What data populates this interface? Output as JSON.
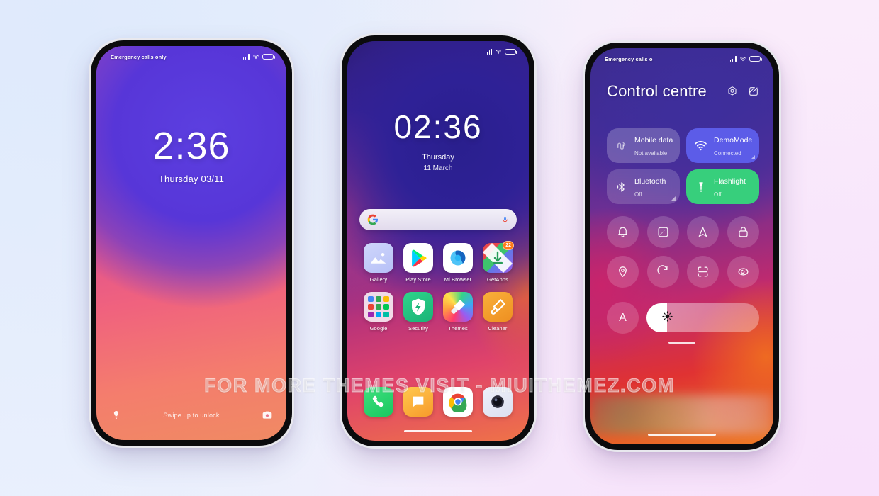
{
  "background": {
    "top_left": "#e3edfc",
    "bottom_right": "#f7e4fb"
  },
  "watermark": {
    "text": "FOR MORE THEMES VISIT - MIUITHEMEZ.COM"
  },
  "phone_lock": {
    "status_bar": {
      "carrier": "Emergency calls only",
      "signal_icon": "signal-bars-icon",
      "wifi_icon": "wifi-icon",
      "battery_icon": "battery-icon"
    },
    "clock": {
      "time": "2:36",
      "date": "Thursday 03/11"
    },
    "footer": {
      "hint": "Swipe up to unlock",
      "left_icon": "flashlight-icon",
      "right_icon": "camera-icon"
    }
  },
  "phone_home": {
    "status_bar": {
      "carrier": "",
      "signal_icon": "signal-bars-icon",
      "wifi_icon": "wifi-icon",
      "battery_icon": "battery-icon"
    },
    "clock": {
      "time": "02:36",
      "day": "Thursday",
      "date": "11 March"
    },
    "search": {
      "placeholder": "",
      "value": "",
      "left_icon": "google-g-icon",
      "right_icon": "microphone-icon"
    },
    "app_rows": [
      [
        {
          "label": "Gallery",
          "icon": "gallery-icon",
          "badge": ""
        },
        {
          "label": "Play Store",
          "icon": "play-store-icon",
          "badge": ""
        },
        {
          "label": "Mi Browser",
          "icon": "mi-browser-icon",
          "badge": ""
        },
        {
          "label": "GetApps",
          "icon": "getapps-icon",
          "badge": "22"
        }
      ],
      [
        {
          "label": "Google",
          "icon": "google-folder-icon",
          "badge": ""
        },
        {
          "label": "Security",
          "icon": "security-icon",
          "badge": ""
        },
        {
          "label": "Themes",
          "icon": "themes-icon",
          "badge": ""
        },
        {
          "label": "Cleaner",
          "icon": "cleaner-icon",
          "badge": ""
        }
      ]
    ],
    "dock": [
      {
        "label": "Phone",
        "icon": "phone-icon"
      },
      {
        "label": "Messages",
        "icon": "messages-icon"
      },
      {
        "label": "Chrome",
        "icon": "chrome-icon"
      },
      {
        "label": "Camera",
        "icon": "camera-app-icon"
      }
    ]
  },
  "phone_cc": {
    "status_bar": {
      "carrier": "Emergency calls o",
      "signal_icon": "signal-bars-icon",
      "wifi_icon": "wifi-icon",
      "battery_icon": "battery-icon"
    },
    "title": "Control centre",
    "actions": [
      {
        "name": "settings-hex-icon"
      },
      {
        "name": "edit-icon"
      }
    ],
    "tiles": [
      {
        "name": "Mobile data",
        "sub": "Not available",
        "icon": "mobile-data-icon",
        "state": "dim",
        "expand": false
      },
      {
        "name": "DemoMode",
        "sub": "Connected",
        "icon": "wifi-tile-icon",
        "state": "blue",
        "expand": true,
        "color": "#5c5ce8"
      },
      {
        "name": "Bluetooth",
        "sub": "Off",
        "icon": "bluetooth-icon",
        "state": "off",
        "expand": true
      },
      {
        "name": "Flashlight",
        "sub": "Off",
        "icon": "flashlight-tile-icon",
        "state": "green",
        "expand": false,
        "color": "#37cf7c"
      }
    ],
    "toggles": [
      [
        {
          "name": "silent-bell-icon"
        },
        {
          "name": "notes-edit-icon"
        },
        {
          "name": "navigation-arrow-icon"
        },
        {
          "name": "screen-lock-icon"
        }
      ],
      [
        {
          "name": "location-pin-icon"
        },
        {
          "name": "auto-rotate-icon"
        },
        {
          "name": "scanner-icon"
        },
        {
          "name": "eye-comfort-icon"
        }
      ]
    ],
    "brightness": {
      "auto_label": "A",
      "value_percent": 18,
      "icon": "sun-brightness-icon"
    }
  }
}
